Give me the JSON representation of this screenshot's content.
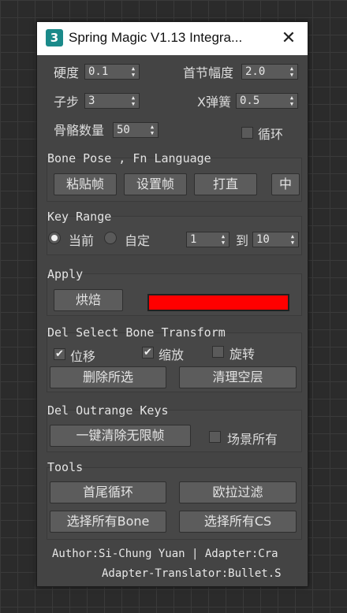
{
  "window": {
    "title": "Spring Magic V1.13 Integra...",
    "app_icon_text": "3",
    "close_glyph": "✕"
  },
  "params": {
    "hardness_label": "硬度",
    "hardness_value": "0.1",
    "first_amp_label": "首节幅度",
    "first_amp_value": "2.0",
    "substep_label": "子步",
    "substep_value": "3",
    "x_spring_label": "X弹簧",
    "x_spring_value": "0.5",
    "bone_count_label": "骨骼数量",
    "bone_count_value": "50",
    "loop_label": "循环",
    "loop_checked": false
  },
  "bone_pose": {
    "title": "Bone Pose , Fn Language",
    "paste_frame": "粘贴帧",
    "set_frame": "设置帧",
    "straighten": "打直",
    "language": "中"
  },
  "key_range": {
    "title": "Key Range",
    "current_label": "当前",
    "custom_label": "自定",
    "selected": "current",
    "from_value": "1",
    "to_label": "到",
    "to_value": "10"
  },
  "apply": {
    "title": "Apply",
    "bake_button": "烘焙",
    "color": "#ff0000"
  },
  "del_select": {
    "title": "Del Select Bone Transform",
    "move_label": "位移",
    "move_checked": true,
    "scale_label": "缩放",
    "scale_checked": true,
    "rotate_label": "旋转",
    "rotate_checked": false,
    "delete_selected": "删除所选",
    "clean_empty": "清理空层"
  },
  "del_outrange": {
    "title": "Del Outrange Keys",
    "clear_infinite": "一键清除无限帧",
    "scene_all_label": "场景所有",
    "scene_all_checked": false
  },
  "tools": {
    "title": "Tools",
    "loop_ends": "首尾循环",
    "euler_filter": "欧拉过滤",
    "select_all_bone": "选择所有Bone",
    "select_all_cs": "选择所有CS"
  },
  "footer": {
    "line1": "Author:Si-Chung Yuan  |  Adapter:Cra",
    "line2": "Adapter-Translator:Bullet.S"
  },
  "check_glyph": "✔",
  "spin_arrows": "▲▼"
}
